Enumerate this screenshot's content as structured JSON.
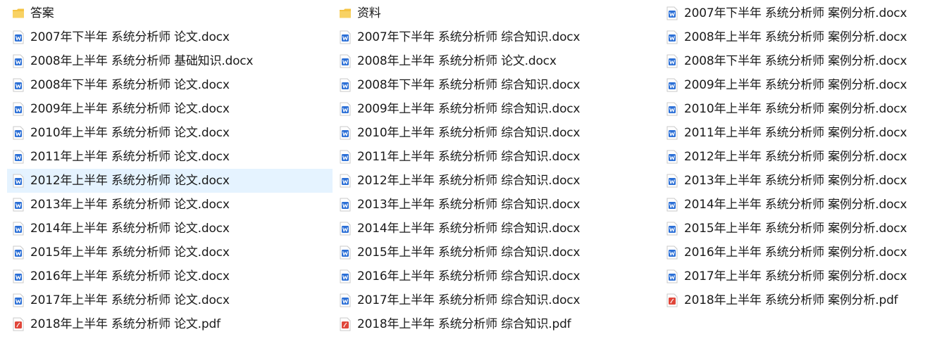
{
  "colors": {
    "selected_bg": "#e5f3ff",
    "folder": "#f5c342",
    "word_icon": "#2b6fd6",
    "pdf_icon": "#e0463a"
  },
  "columns": [
    {
      "items": [
        {
          "name": "答案",
          "type": "folder",
          "icon": "folder-icon"
        },
        {
          "name": "2007年下半年 系统分析师 论文.docx",
          "type": "docx",
          "icon": "word-doc-icon"
        },
        {
          "name": "2008年上半年 系统分析师 基础知识.docx",
          "type": "docx",
          "icon": "word-doc-icon"
        },
        {
          "name": "2008年下半年 系统分析师 论文.docx",
          "type": "docx",
          "icon": "word-doc-icon"
        },
        {
          "name": "2009年上半年 系统分析师 论文.docx",
          "type": "docx",
          "icon": "word-doc-icon"
        },
        {
          "name": "2010年上半年 系统分析师 论文.docx",
          "type": "docx",
          "icon": "word-doc-icon"
        },
        {
          "name": "2011年上半年 系统分析师 论文.docx",
          "type": "docx",
          "icon": "word-doc-icon"
        },
        {
          "name": "2012年上半年 系统分析师 论文.docx",
          "type": "docx",
          "icon": "word-doc-icon",
          "selected": true
        },
        {
          "name": "2013年上半年 系统分析师 论文.docx",
          "type": "docx",
          "icon": "word-doc-icon"
        },
        {
          "name": "2014年上半年 系统分析师 论文.docx",
          "type": "docx",
          "icon": "word-doc-icon"
        },
        {
          "name": "2015年上半年 系统分析师 论文.docx",
          "type": "docx",
          "icon": "word-doc-icon"
        },
        {
          "name": "2016年上半年 系统分析师 论文.docx",
          "type": "docx",
          "icon": "word-doc-icon"
        },
        {
          "name": "2017年上半年 系统分析师 论文.docx",
          "type": "docx",
          "icon": "word-doc-icon"
        },
        {
          "name": "2018年上半年 系统分析师 论文.pdf",
          "type": "pdf",
          "icon": "pdf-icon"
        }
      ]
    },
    {
      "items": [
        {
          "name": "资料",
          "type": "folder",
          "icon": "folder-icon"
        },
        {
          "name": "2007年下半年 系统分析师 综合知识.docx",
          "type": "docx",
          "icon": "word-doc-icon"
        },
        {
          "name": "2008年上半年 系统分析师 论文.docx",
          "type": "docx",
          "icon": "word-doc-icon"
        },
        {
          "name": "2008年下半年 系统分析师 综合知识.docx",
          "type": "docx",
          "icon": "word-doc-icon"
        },
        {
          "name": "2009年上半年 系统分析师 综合知识.docx",
          "type": "docx",
          "icon": "word-doc-icon"
        },
        {
          "name": "2010年上半年 系统分析师 综合知识.docx",
          "type": "docx",
          "icon": "word-doc-icon"
        },
        {
          "name": "2011年上半年 系统分析师 综合知识.docx",
          "type": "docx",
          "icon": "word-doc-icon"
        },
        {
          "name": "2012年上半年 系统分析师 综合知识.docx",
          "type": "docx",
          "icon": "word-doc-icon"
        },
        {
          "name": "2013年上半年 系统分析师 综合知识.docx",
          "type": "docx",
          "icon": "word-doc-icon"
        },
        {
          "name": "2014年上半年 系统分析师 综合知识.docx",
          "type": "docx",
          "icon": "word-doc-icon"
        },
        {
          "name": "2015年上半年 系统分析师 综合知识.docx",
          "type": "docx",
          "icon": "word-doc-icon"
        },
        {
          "name": "2016年上半年 系统分析师 综合知识.docx",
          "type": "docx",
          "icon": "word-doc-icon"
        },
        {
          "name": "2017年上半年 系统分析师 综合知识.docx",
          "type": "docx",
          "icon": "word-doc-icon"
        },
        {
          "name": "2018年上半年 系统分析师 综合知识.pdf",
          "type": "pdf",
          "icon": "pdf-icon"
        }
      ]
    },
    {
      "items": [
        {
          "name": "2007年下半年 系统分析师 案例分析.docx",
          "type": "docx",
          "icon": "word-doc-icon"
        },
        {
          "name": "2008年上半年 系统分析师 案例分析.docx",
          "type": "docx",
          "icon": "word-doc-icon"
        },
        {
          "name": "2008年下半年 系统分析师 案例分析.docx",
          "type": "docx",
          "icon": "word-doc-icon"
        },
        {
          "name": "2009年上半年 系统分析师 案例分析.docx",
          "type": "docx",
          "icon": "word-doc-icon"
        },
        {
          "name": "2010年上半年 系统分析师 案例分析.docx",
          "type": "docx",
          "icon": "word-doc-icon"
        },
        {
          "name": "2011年上半年 系统分析师 案例分析.docx",
          "type": "docx",
          "icon": "word-doc-icon"
        },
        {
          "name": "2012年上半年 系统分析师 案例分析.docx",
          "type": "docx",
          "icon": "word-doc-icon"
        },
        {
          "name": "2013年上半年 系统分析师 案例分析.docx",
          "type": "docx",
          "icon": "word-doc-icon"
        },
        {
          "name": "2014年上半年 系统分析师 案例分析.docx",
          "type": "docx",
          "icon": "word-doc-icon"
        },
        {
          "name": "2015年上半年 系统分析师 案例分析.docx",
          "type": "docx",
          "icon": "word-doc-icon"
        },
        {
          "name": "2016年上半年 系统分析师 案例分析.docx",
          "type": "docx",
          "icon": "word-doc-icon"
        },
        {
          "name": "2017年上半年 系统分析师 案例分析.docx",
          "type": "docx",
          "icon": "word-doc-icon"
        },
        {
          "name": "2018年上半年 系统分析师  案例分析.pdf",
          "type": "pdf",
          "icon": "pdf-icon"
        }
      ]
    }
  ]
}
